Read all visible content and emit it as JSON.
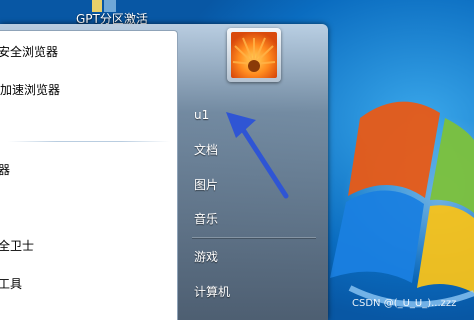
{
  "desktop": {
    "shortcut_label": "GPT分区激活"
  },
  "start_menu": {
    "programs": [
      {
        "label": "安全浏览器",
        "icon": "browser-icon"
      },
      {
        "label": "加速浏览器",
        "icon": "browser-icon"
      },
      {
        "label": "器",
        "icon": "app-icon"
      },
      {
        "label": "全卫士",
        "icon": "security-icon"
      },
      {
        "label": "工具",
        "icon": "tools-icon"
      }
    ],
    "user_links": {
      "user_name": "u1",
      "documents": "文档",
      "pictures": "图片",
      "music": "音乐",
      "games": "游戏",
      "computer": "计算机"
    },
    "avatar": {
      "icon": "flower-avatar-icon"
    }
  },
  "annotation": {
    "arrow_color": "#2f55d4"
  },
  "watermark": "CSDN @(_U_U_)...zzz"
}
